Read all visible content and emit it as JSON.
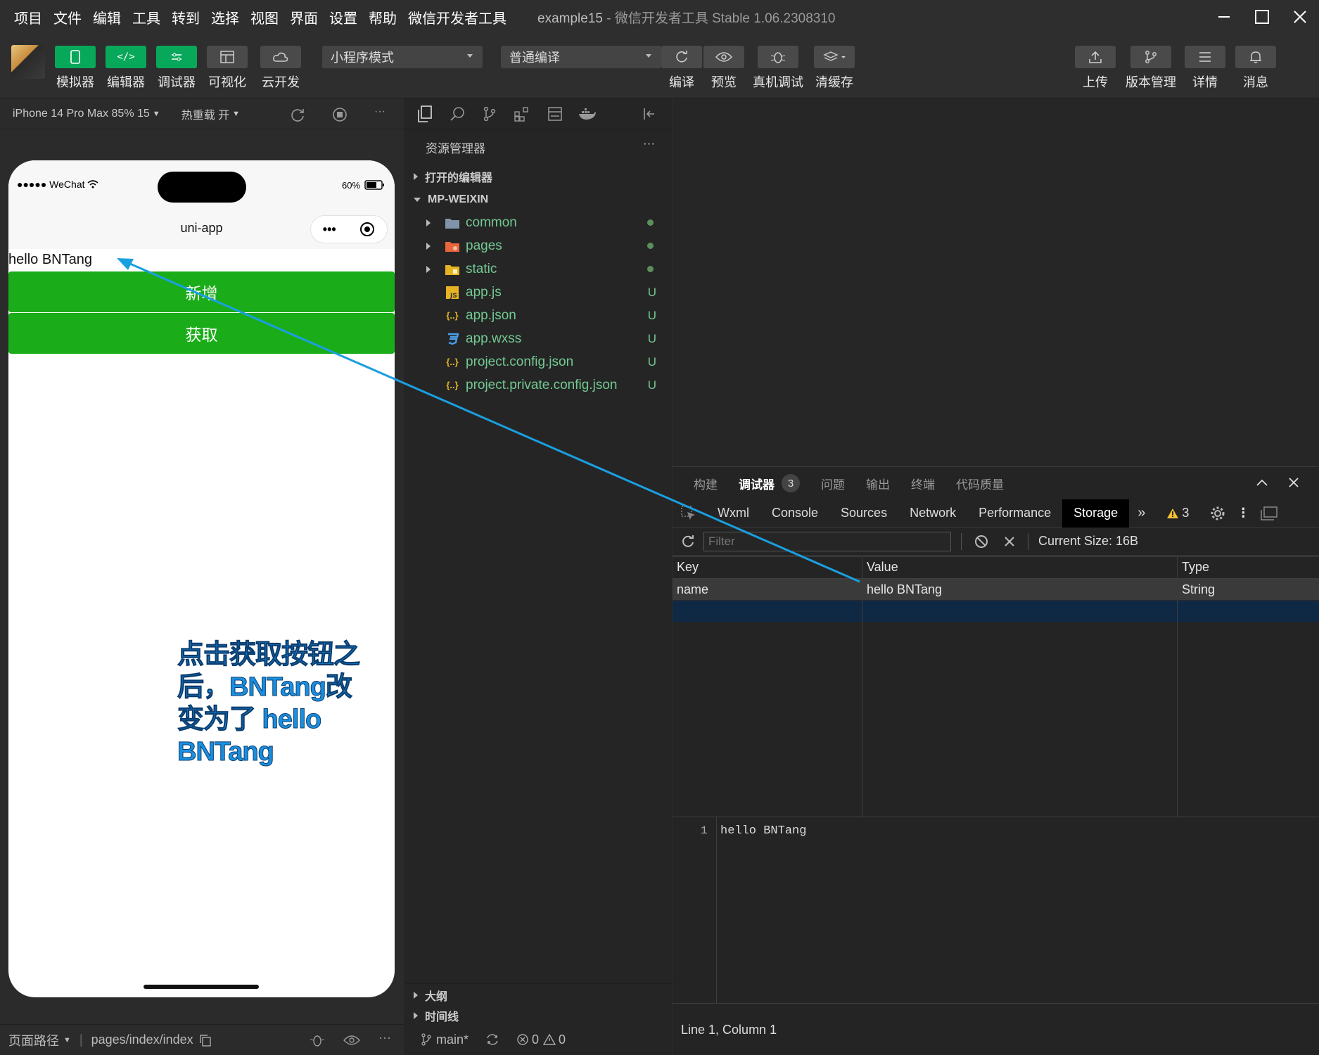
{
  "menu": {
    "items": [
      "项目",
      "文件",
      "编辑",
      "工具",
      "转到",
      "选择",
      "视图",
      "界面",
      "设置",
      "帮助",
      "微信开发者工具"
    ],
    "project": "example15",
    "title_suffix": " - 微信开发者工具 Stable 1.06.2308310"
  },
  "toolbar": {
    "simulator": "模拟器",
    "editor": "编辑器",
    "debugger": "调试器",
    "visual": "可视化",
    "cloud": "云开发",
    "mode_select": "小程序模式",
    "compile_select": "普通编译",
    "compile": "编译",
    "preview": "预览",
    "real_debug": "真机调试",
    "clear_cache": "清缓存",
    "upload": "上传",
    "version": "版本管理",
    "details": "详情",
    "messages": "消息"
  },
  "simulator": {
    "device": "iPhone 14 Pro Max 85% 15",
    "hot_reload": "热重载 开",
    "carrier": "●●●●● WeChat",
    "battery": "60%",
    "nav_title": "uni-app",
    "page_text": "hello BNTang",
    "btn_add": "新增",
    "btn_get": "获取",
    "annotation": "点击获取按钮之后，BNTang改变为了 hello BNTang",
    "footer_path_label": "页面路径",
    "footer_path": "pages/index/index"
  },
  "explorer": {
    "title": "资源管理器",
    "open_editors": "打开的编辑器",
    "root": "MP-WEIXIN",
    "folders": [
      "common",
      "pages",
      "static"
    ],
    "files": [
      {
        "name": "app.js",
        "status": "U"
      },
      {
        "name": "app.json",
        "status": "U"
      },
      {
        "name": "app.wxss",
        "status": "U"
      },
      {
        "name": "project.config.json",
        "status": "U"
      },
      {
        "name": "project.private.config.json",
        "status": "U"
      }
    ],
    "outline": "大纲",
    "timeline": "时间线",
    "branch": "main*",
    "errors": "0",
    "warnings": "0"
  },
  "debugger": {
    "tabs": [
      "构建",
      "调试器",
      "问题",
      "输出",
      "终端",
      "代码质量"
    ],
    "active_tab": "调试器",
    "badge": "3",
    "devtools_tabs": [
      "Wxml",
      "Console",
      "Sources",
      "Network",
      "Performance",
      "Storage"
    ],
    "active_devtools": "Storage",
    "warn_count": "3",
    "filter_placeholder": "Filter",
    "current_size": "Current Size: 16B",
    "columns": [
      "Key",
      "Value",
      "Type"
    ],
    "rows": [
      {
        "key": "name",
        "value": "hello BNTang",
        "type": "String"
      }
    ],
    "preview_line_no": "1",
    "preview_text": "hello BNTang",
    "status": "Line 1, Column 1"
  },
  "colors": {
    "accent_green": "#08a85a",
    "wechat_btn": "#1aad19",
    "arrow": "#1a9fe0"
  }
}
